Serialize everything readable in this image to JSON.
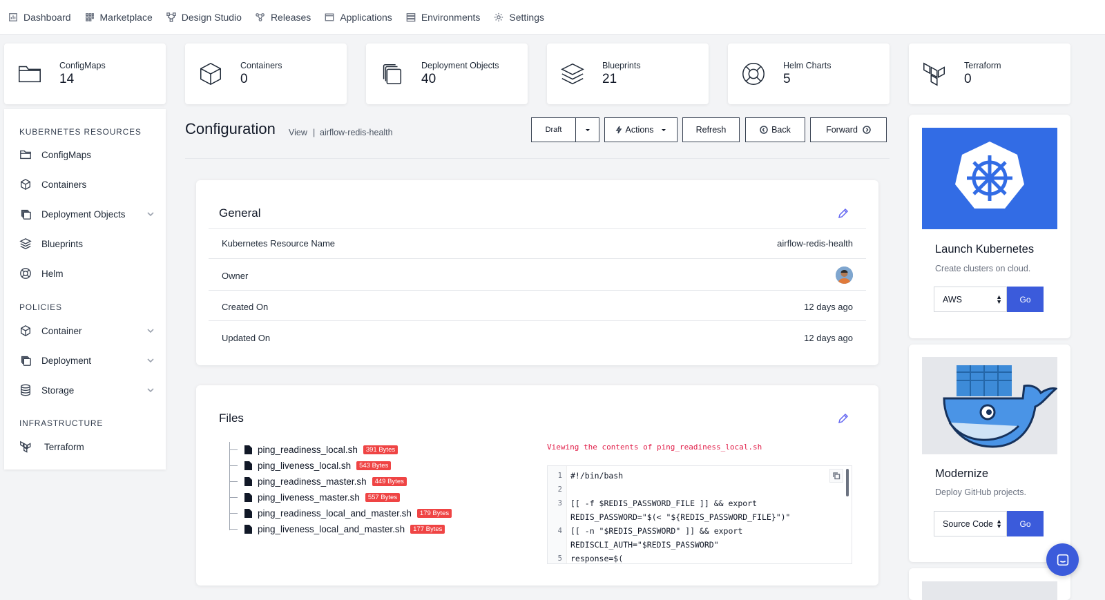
{
  "nav": [
    {
      "label": "Dashboard",
      "icon": "chart-icon"
    },
    {
      "label": "Marketplace",
      "icon": "grid-icon"
    },
    {
      "label": "Design Studio",
      "icon": "design-icon"
    },
    {
      "label": "Releases",
      "icon": "releases-icon"
    },
    {
      "label": "Applications",
      "icon": "window-icon"
    },
    {
      "label": "Environments",
      "icon": "server-icon"
    },
    {
      "label": "Settings",
      "icon": "gear-icon"
    }
  ],
  "stats": [
    {
      "label": "ConfigMaps",
      "value": "14",
      "icon": "folder-icon"
    },
    {
      "label": "Containers",
      "value": "0",
      "icon": "cube-icon"
    },
    {
      "label": "Deployment Objects",
      "value": "40",
      "icon": "copy-icon"
    },
    {
      "label": "Blueprints",
      "value": "21",
      "icon": "layers-icon"
    },
    {
      "label": "Helm Charts",
      "value": "5",
      "icon": "lifebuoy-icon"
    },
    {
      "label": "Terraform",
      "value": "0",
      "icon": "terraform-icon"
    }
  ],
  "sidebar": {
    "sections": [
      "KUBERNETES RESOURCES",
      "POLICIES",
      "INFRASTRUCTURE"
    ],
    "items": [
      {
        "label": "ConfigMaps",
        "icon": "folder-icon"
      },
      {
        "label": "Containers",
        "icon": "cube-icon"
      },
      {
        "label": "Deployment Objects",
        "icon": "copy-icon"
      },
      {
        "label": "Blueprints",
        "icon": "layers-icon"
      },
      {
        "label": "Helm",
        "icon": "lifebuoy-icon"
      },
      {
        "label": "Container",
        "icon": "cube-icon"
      },
      {
        "label": "Deployment",
        "icon": "copy-icon"
      },
      {
        "label": "Storage",
        "icon": "database-icon"
      },
      {
        "label": "Terraform",
        "icon": "terraform-icon"
      }
    ]
  },
  "header": {
    "title": "Configuration",
    "view": "View",
    "separator": "|",
    "resource": "airflow-redis-health",
    "buttons": {
      "draft": "Draft",
      "actions": "Actions",
      "refresh": "Refresh",
      "back": "Back",
      "forward": "Forward"
    }
  },
  "general": {
    "title": "General",
    "rows": [
      {
        "key": "Kubernetes Resource Name",
        "value": "airflow-redis-health"
      },
      {
        "key": "Owner",
        "value": ""
      },
      {
        "key": "Created On",
        "value": "12 days ago"
      },
      {
        "key": "Updated On",
        "value": "12 days ago"
      }
    ]
  },
  "files": {
    "title": "Files",
    "list": [
      {
        "name": "ping_readiness_local.sh",
        "size": "391 Bytes"
      },
      {
        "name": "ping_liveness_local.sh",
        "size": "543 Bytes"
      },
      {
        "name": "ping_readiness_master.sh",
        "size": "449 Bytes"
      },
      {
        "name": "ping_liveness_master.sh",
        "size": "557 Bytes"
      },
      {
        "name": "ping_readiness_local_and_master.sh",
        "size": "179 Bytes"
      },
      {
        "name": "ping_liveness_local_and_master.sh",
        "size": "177 Bytes"
      }
    ],
    "viewing": "Viewing the contents of ping_readiness_local.sh",
    "code": [
      {
        "ln": "1",
        "text": "#!/bin/bash"
      },
      {
        "ln": "2",
        "text": ""
      },
      {
        "ln": "3",
        "text": "[[ -f $REDIS_PASSWORD_FILE ]] && export"
      },
      {
        "ln": "",
        "text": "REDIS_PASSWORD=\"$(< \"${REDIS_PASSWORD_FILE}\")\""
      },
      {
        "ln": "4",
        "text": "[[ -n \"$REDIS_PASSWORD\" ]] && export"
      },
      {
        "ln": "",
        "text": "REDISCLI_AUTH=\"$REDIS_PASSWORD\""
      },
      {
        "ln": "5",
        "text": "response=$("
      }
    ]
  },
  "cards": [
    {
      "title": "Launch Kubernetes",
      "desc": "Create clusters on cloud.",
      "select": "AWS",
      "go": "Go"
    },
    {
      "title": "Modernize",
      "desc": "Deploy GitHub projects.",
      "select": "Source Code",
      "go": "Go"
    }
  ],
  "colors": {
    "accent": "#3b5bdb",
    "kubernetes": "#326ce5",
    "badge": "#ef4444",
    "code_caption": "#e11d48"
  }
}
